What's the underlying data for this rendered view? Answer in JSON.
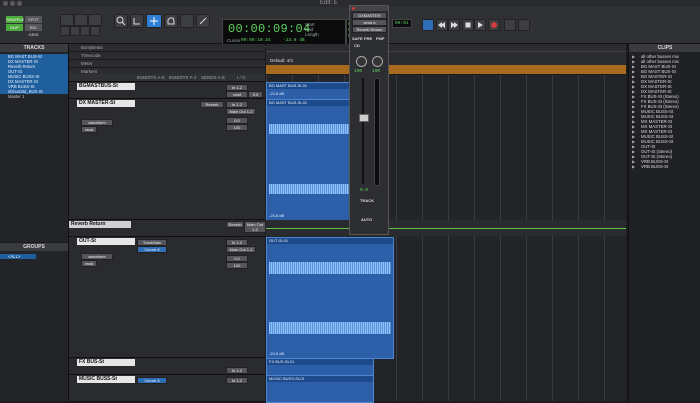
{
  "window": {
    "title": "Edit: E"
  },
  "toolbar": {
    "mode_shuffle": "SHUFFLE",
    "mode_spot": "SPOT",
    "mode_slip": "SLIP",
    "mode_grid": "REL GRID",
    "counter_main": "00:00:09:04",
    "start_label": "Start",
    "end_label": "End",
    "length_label": "Length",
    "start_value": "00:00:09:04",
    "end_value": "00:00:09:04",
    "length_value": "00:00:00:00",
    "cursor_label": "Cursor",
    "cursor_value": "00:00:10:34",
    "db_value": "-23.8 dB",
    "dly_label": "Dly",
    "nudge_value": "00:01"
  },
  "tracks_panel": {
    "title": "TRACKS",
    "items": [
      "BG MAST BUS-St",
      "DX MASTER-St",
      "Reverb Return",
      "OUT-St",
      "MUSIC BUSS-St",
      "DX MASTER-St",
      "VRB BUSS-St",
      "sfxbusStd_BUS-St",
      "Master 1"
    ]
  },
  "groups_panel": {
    "title": "GROUPS",
    "items": [
      "<ALL>"
    ]
  },
  "ruler": {
    "rows": [
      "Bars|Beats",
      "Timecode",
      "Meter",
      "Markers"
    ],
    "default_marker": "Default: 4/4"
  },
  "column_headers": {
    "inserts_ae": "INSERTS A-E",
    "inserts_fj": "INSERTS F-J",
    "sends_ae": "SENDS A-E",
    "io": "I / O"
  },
  "tracks": [
    {
      "name": "BGMASTBUS-St",
      "input": "In 1-2",
      "output": "Main Out 1-2",
      "region": "BG MAST BUS-St-01",
      "level": "-23.8 dB",
      "auto": "read",
      "vol": "0.0",
      "pan": "100"
    },
    {
      "name": "DX MASTER-St",
      "input": "In 1-2",
      "output": "Main Out 1-2",
      "send": "Reverb",
      "region": "BG MAST BUS-St-01",
      "level": "-23.8 dB",
      "view": "waveform",
      "auto": "read",
      "vol": "0.0",
      "pan": "100"
    },
    {
      "name": "Reverb Return",
      "input": "Reverb",
      "output": "Main Out 1-2",
      "vol": "0.0"
    },
    {
      "name": "OUT-St",
      "insert": "TrackGain",
      "insert2": "Ozone 8",
      "input": "In 1-2",
      "output": "Main Out 1-2",
      "region": "OUT-St-01",
      "level": "-23.8 dB",
      "view": "waveform",
      "auto": "read",
      "vol": "0.0",
      "pan": "100"
    },
    {
      "name": "FX BUS-St",
      "input": "In 1-2",
      "region": "FX BUS-St-01"
    },
    {
      "name": "MUSIC BUSS-St",
      "insert": "Ozone 8",
      "input": "In 1-2",
      "region": "MUSIC BUSS-St-01"
    }
  ],
  "mixer_strip": {
    "track": "DXMASTER",
    "send": "send a",
    "send_target": "Reverb Return",
    "buttons": [
      "SAFE",
      "PRE",
      "FMP"
    ],
    "small": "CD",
    "pan_left": "100",
    "pan_right": "100",
    "fader_value": "0.0",
    "track_label": "TRACK",
    "auto_label": "AUTO"
  },
  "clips_panel": {
    "title": "CLIPS",
    "items": [
      "all other busses mix",
      "all other busses mix",
      "BG MAST BUS-St",
      "BG MAST BUS-St",
      "BG MASTER-St",
      "DX MASTER-St",
      "DX MASTER-St",
      "DX MASTER-St",
      "FX BUS-St (Stereo)",
      "FX BUS-St (Stereo)",
      "FX BUS-St (Stereo)",
      "MUSIC BUSS-St",
      "MUSIC BUSS-St",
      "MX MASTER-St",
      "MX MASTER-St",
      "MX MASTER-St",
      "MUSIC BUSS-St",
      "MUSIC BUSS-St",
      "OUT-St",
      "OUT-St (Stereo)",
      "OUT-St (Stereo)",
      "VRB BUSS-St",
      "VRB BUSS-St"
    ]
  },
  "colors": {
    "region": "#2c5fa8",
    "selection": "#1f5f9e",
    "counter": "#5fd35f",
    "record": "#d23b3b"
  }
}
